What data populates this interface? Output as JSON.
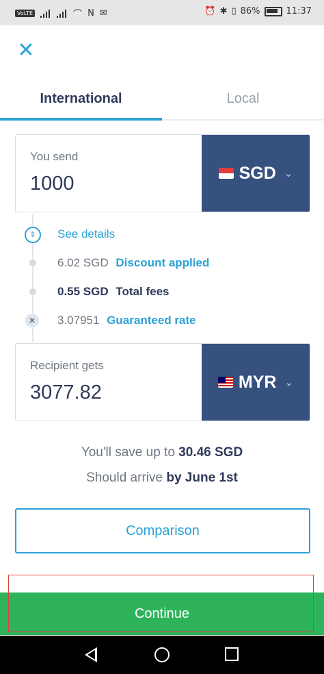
{
  "status_bar": {
    "volte": "VoLTE",
    "battery": "86%",
    "time": "11:37"
  },
  "tabs": [
    {
      "label": "International",
      "active": true
    },
    {
      "label": "Local",
      "active": false
    }
  ],
  "send": {
    "label": "You send",
    "amount": "1000",
    "currency": "SGD"
  },
  "details": {
    "link": "See details",
    "discount_value": "6.02 SGD",
    "discount_label": "Discount applied",
    "fees_value": "0.55 SGD",
    "fees_label": "Total fees",
    "rate_value": "3.07951",
    "rate_label": "Guaranteed rate"
  },
  "receive": {
    "label": "Recipient gets",
    "amount": "3077.82",
    "currency": "MYR"
  },
  "summary": {
    "save_prefix": "You'll save up to",
    "save_amount": "30.46 SGD",
    "arrive_prefix": "Should arrive",
    "arrive_date": "by June 1st"
  },
  "buttons": {
    "comparison": "Comparison",
    "continue": "Continue"
  },
  "colors": {
    "accent": "#2aa2d6",
    "currency_bg": "#37517e",
    "continue_bg": "#2eb35a",
    "text_dark": "#2e3a59"
  },
  "icons": [
    "close-icon",
    "chevron-down-icon",
    "details-toggle-icon",
    "multiply-icon",
    "back-icon",
    "home-icon",
    "recents-icon"
  ]
}
